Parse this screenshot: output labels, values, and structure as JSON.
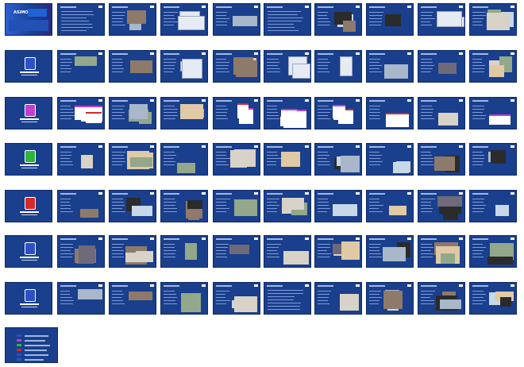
{
  "cover": {
    "logo_text": "ASIMO"
  },
  "rows": [
    {
      "section_color": "#2d4fc7",
      "thumbs": [
        "text",
        "photo",
        "diagram",
        "photo",
        "text",
        "photo",
        "photo",
        "diagram",
        "photo",
        "photo"
      ]
    },
    {
      "section_color": "#3a6fd8",
      "thumbs": [
        "photo",
        "photo",
        "diagram",
        "photo",
        "diagram",
        "diagram",
        "photo",
        "photo",
        "photo",
        "diagram"
      ]
    },
    {
      "section_color": "#c23dd1",
      "thumbs": [
        "logo",
        "photo",
        "photo",
        "logo",
        "logo",
        "logo",
        "logo",
        "photo",
        "logo",
        "photo"
      ]
    },
    {
      "section_color": "#2fb53c",
      "thumbs": [
        "photo",
        "photo",
        "photo",
        "photo",
        "photo",
        "photo",
        "photo",
        "photo",
        "photo",
        "photo"
      ]
    },
    {
      "section_color": "#d62a2a",
      "thumbs": [
        "photo",
        "photo",
        "photo",
        "photo",
        "photo",
        "photo",
        "photo",
        "photo",
        "photo",
        "photo"
      ]
    },
    {
      "section_color": "#2d4fc7",
      "thumbs": [
        "photo",
        "photo",
        "photo",
        "photo",
        "photo",
        "photo",
        "photo",
        "photo",
        "photo",
        "photo"
      ]
    },
    {
      "section_color": "#2d4fc7",
      "thumbs": [
        "photo",
        "photo",
        "photo",
        "photo",
        "text",
        "photo",
        "photo",
        "photo",
        "photo",
        "photo"
      ]
    }
  ],
  "colors": {
    "slide_bg": "#1a3f8c",
    "thumb_photo": "#d8d2c8",
    "thumb_logo": "#ffffff",
    "thumb_diagram": "#e6eaf2",
    "accent_red": "#d62a2a",
    "accent_magenta": "#c23dd1",
    "accent_green": "#2fb53c"
  }
}
